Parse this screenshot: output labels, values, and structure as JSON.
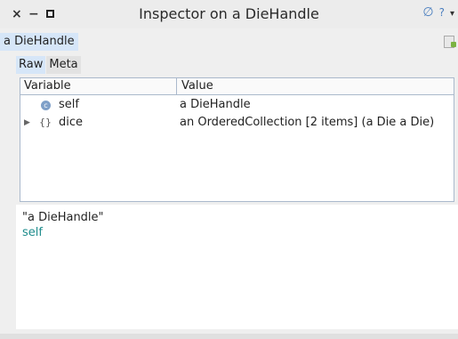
{
  "window": {
    "title": "Inspector on a DieHandle",
    "controls": {
      "close": "×",
      "minimize": "−",
      "maximize": ""
    },
    "right_icons": {
      "remove": "∅",
      "help": "?",
      "menu": "▾"
    }
  },
  "object_tab": {
    "label": "a DieHandle"
  },
  "subtabs": [
    "Raw",
    "Meta"
  ],
  "table": {
    "columns": [
      "Variable",
      "Value"
    ],
    "rows": [
      {
        "icon": "c",
        "expandable": false,
        "name": "self",
        "value": "a DieHandle"
      },
      {
        "icon": "{}",
        "expandable": true,
        "name": "dice",
        "value": "an OrderedCollection [2 items] (a Die a Die)"
      }
    ]
  },
  "code": {
    "lines": [
      "\"a DieHandle\"",
      "self"
    ]
  },
  "colors": {
    "accent": "#d6e6f8",
    "keyword": "#1e8c8c",
    "border": "#aab9cc"
  }
}
